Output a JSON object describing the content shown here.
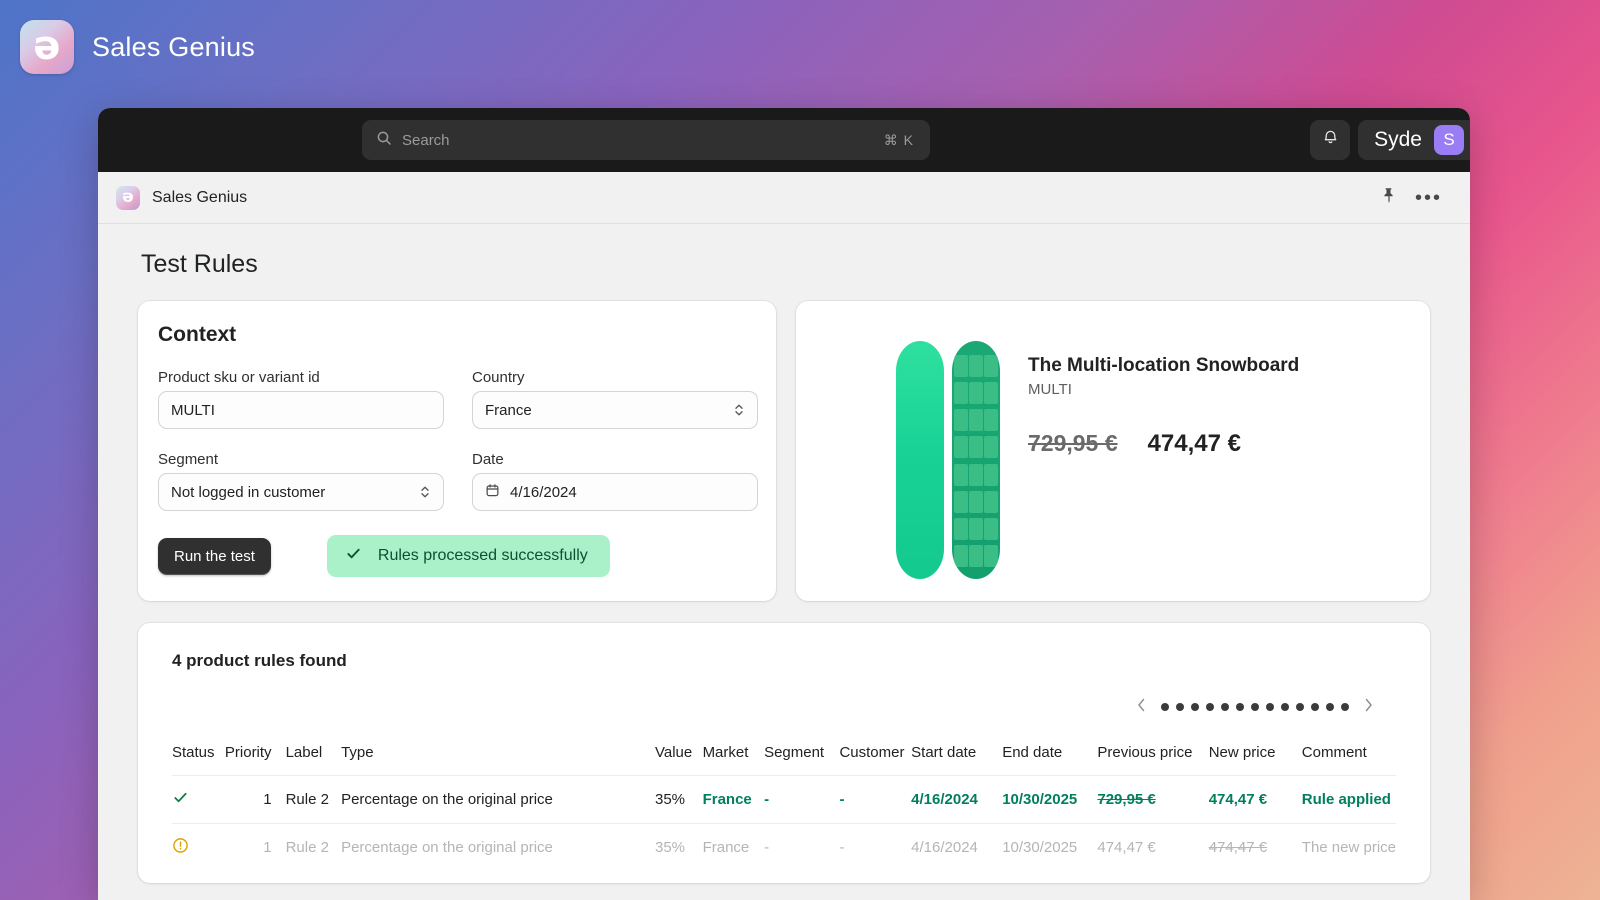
{
  "brand": {
    "title": "Sales Genius",
    "logo_icon": "sales-genius-logo-icon",
    "logo_glyph": "ə"
  },
  "topbar": {
    "search": {
      "placeholder": "Search",
      "value": "",
      "icon": "search-icon",
      "shortcut": "⌘ K"
    },
    "notifications_icon": "bell-icon",
    "user": {
      "name": "Syde",
      "avatar_initial": "S",
      "avatar_color": "#9a7cf5"
    }
  },
  "subheader": {
    "app_name": "Sales Genius",
    "pin_icon": "pin-icon",
    "more_icon": "more-horizontal-icon",
    "more_label": "•••"
  },
  "page": {
    "title": "Test Rules"
  },
  "context": {
    "heading": "Context",
    "fields": {
      "sku": {
        "label": "Product sku or variant id",
        "value": "MULTI",
        "placeholder": "Product sku or variant id"
      },
      "country": {
        "label": "Country",
        "value": "France"
      },
      "segment": {
        "label": "Segment",
        "value": "Not logged in customer"
      },
      "date": {
        "label": "Date",
        "value": "4/16/2024",
        "icon": "calendar-icon"
      }
    },
    "run_button": "Run the test",
    "status_banner": {
      "text": "Rules processed successfully",
      "icon": "check-icon",
      "bg": "#aaf0c8",
      "fg": "#0b5132"
    }
  },
  "product": {
    "title": "The Multi-location Snowboard",
    "sku": "MULTI",
    "price_original": "729,95 €",
    "price_current": "474,47 €",
    "image_alt": "green snowboard pair"
  },
  "rules": {
    "found_text": "4 product rules found",
    "pager": {
      "prev_icon": "chevron-left-icon",
      "next_icon": "chevron-right-icon",
      "dot_count": 13,
      "active_index": 0
    },
    "columns": [
      "Status",
      "Priority",
      "Label",
      "Type",
      "Value",
      "Market",
      "Segment",
      "Customer",
      "Start date",
      "End date",
      "Previous price",
      "New price",
      "Comment"
    ],
    "rows": [
      {
        "status_icon": "check-icon",
        "status_state": "applied",
        "priority": "1",
        "label": "Rule 2",
        "type": "Percentage on the original price",
        "value": "35%",
        "market": "France",
        "segment": "-",
        "customer": "-",
        "start_date": "4/16/2024",
        "end_date": "10/30/2025",
        "previous_price": "729,95 €",
        "new_price": "474,47 €",
        "comment": "Rule applied",
        "muted": false
      },
      {
        "status_icon": "warning-icon",
        "status_state": "warning",
        "priority": "1",
        "label": "Rule 2",
        "type": "Percentage on the original price",
        "value": "35%",
        "market": "France",
        "segment": "-",
        "customer": "-",
        "start_date": "4/16/2024",
        "end_date": "10/30/2025",
        "previous_price": "474,47 €",
        "new_price": "474,47 €",
        "comment": "The new price",
        "muted": true
      }
    ]
  }
}
